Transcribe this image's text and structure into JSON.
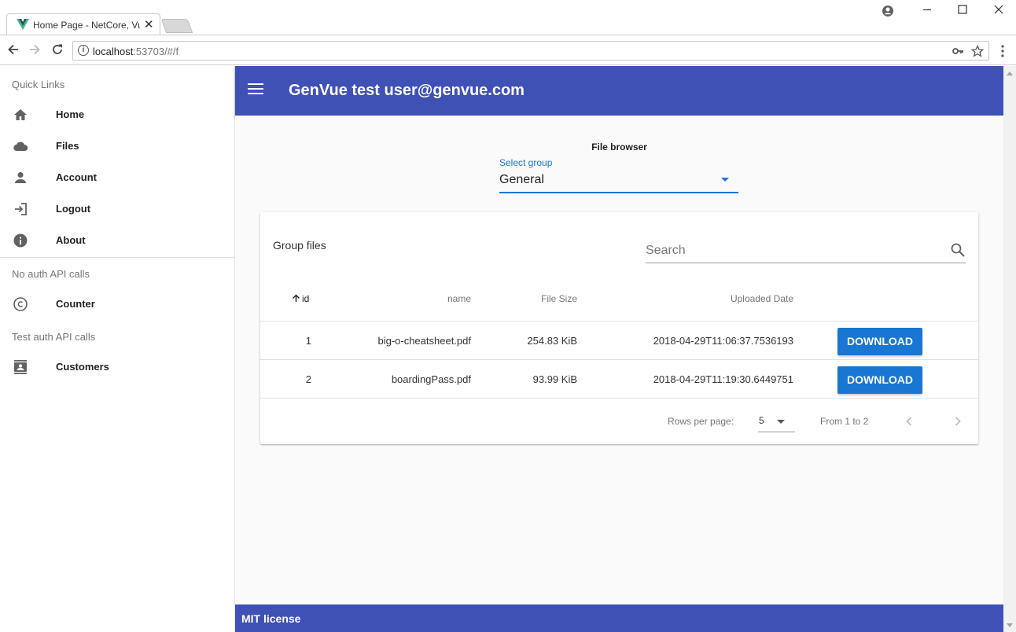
{
  "browser": {
    "tab_title": "Home Page - NetCore, Vue",
    "tab_close": "✕",
    "url_host": "localhost",
    "url_rest": ":53703/#/f",
    "window_controls": [
      "minimize",
      "maximize",
      "close"
    ]
  },
  "sidebar": {
    "sections": [
      {
        "subheader": "Quick Links",
        "items": [
          {
            "label": "Home",
            "icon": "home-icon"
          },
          {
            "label": "Files",
            "icon": "cloud-icon"
          },
          {
            "label": "Account",
            "icon": "person-icon"
          },
          {
            "label": "Logout",
            "icon": "logout-icon"
          },
          {
            "label": "About",
            "icon": "info-icon"
          }
        ]
      },
      {
        "subheader": "No auth API calls",
        "items": [
          {
            "label": "Counter",
            "icon": "copyright-icon"
          }
        ]
      },
      {
        "subheader": "Test auth API calls",
        "items": [
          {
            "label": "Customers",
            "icon": "contacts-icon"
          }
        ]
      }
    ]
  },
  "appbar": {
    "title": "GenVue test user@genvue.com"
  },
  "main": {
    "heading": "File browser",
    "group_select": {
      "label": "Select group",
      "value": "General"
    },
    "table": {
      "title": "Group files",
      "search_placeholder": "Search",
      "headers": [
        "id",
        "name",
        "File Size",
        "Uploaded Date"
      ],
      "rows": [
        {
          "id": "1",
          "name": "big-o-cheatsheet.pdf",
          "size": "254.83 KiB",
          "date": "2018-04-29T11:06:37.7536193",
          "action": "DOWNLOAD"
        },
        {
          "id": "2",
          "name": "boardingPass.pdf",
          "size": "93.99 KiB",
          "date": "2018-04-29T11:19:30.6449751",
          "action": "DOWNLOAD"
        }
      ],
      "rows_per_page_label": "Rows per page:",
      "rows_per_page_value": "5",
      "range_text": "From 1 to 2"
    }
  },
  "footer": {
    "text": "MIT license"
  },
  "colors": {
    "primary": "#3f51b5",
    "accent": "#1976d2"
  }
}
